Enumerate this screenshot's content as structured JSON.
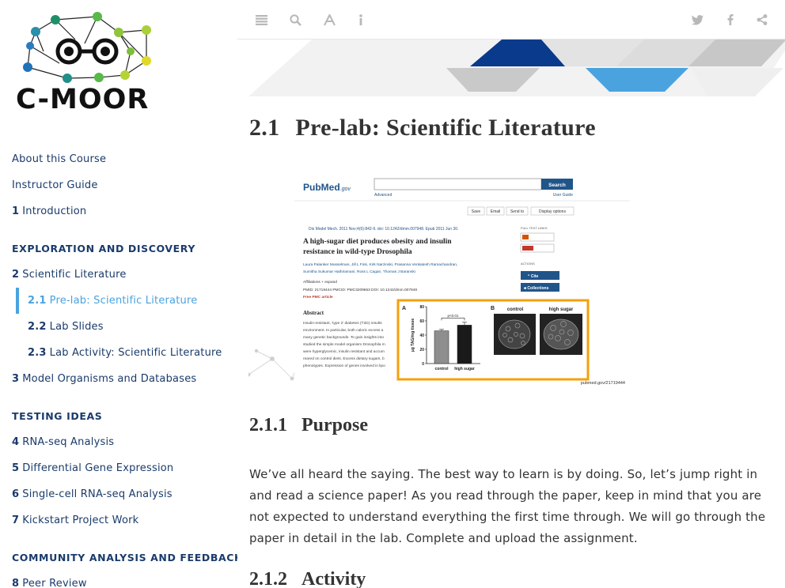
{
  "logo": {
    "text": "C-MOOR"
  },
  "sidebar": {
    "items": [
      {
        "type": "link",
        "num": "",
        "label": "About this Course"
      },
      {
        "type": "link",
        "num": "",
        "label": "Instructor Guide"
      },
      {
        "type": "link",
        "num": "1",
        "label": "Introduction"
      },
      {
        "type": "header",
        "num": "",
        "label": "EXPLORATION AND DISCOVERY"
      },
      {
        "type": "link",
        "num": "2",
        "label": "Scientific Literature"
      },
      {
        "type": "sub-active",
        "num": "2.1",
        "label": "Pre-lab: Scientific Literature"
      },
      {
        "type": "sub",
        "num": "2.2",
        "label": "Lab Slides"
      },
      {
        "type": "sub",
        "num": "2.3",
        "label": "Lab Activity: Scientific Literature"
      },
      {
        "type": "link",
        "num": "3",
        "label": "Model Organisms and Databases"
      },
      {
        "type": "header",
        "num": "",
        "label": "TESTING IDEAS"
      },
      {
        "type": "link",
        "num": "4",
        "label": "RNA-seq Analysis"
      },
      {
        "type": "link",
        "num": "5",
        "label": "Differential Gene Expression"
      },
      {
        "type": "link",
        "num": "6",
        "label": "Single-cell RNA-seq Analysis"
      },
      {
        "type": "link",
        "num": "7",
        "label": "Kickstart Project Work"
      },
      {
        "type": "header",
        "num": "",
        "label": "COMMUNITY ANALYSIS AND FEEDBACK"
      },
      {
        "type": "link",
        "num": "8",
        "label": "Peer Review"
      }
    ]
  },
  "toolbar": {
    "left_icons": [
      "menu-icon",
      "search-icon",
      "font-icon",
      "info-icon"
    ],
    "right_icons": [
      "twitter-icon",
      "facebook-icon",
      "share-icon"
    ]
  },
  "colors": {
    "accent": "#4aa3df",
    "nav": "#1a3b6b",
    "banner_dark": "#0a3a8c",
    "banner_light": "#4aa3df",
    "highlight": "#f5a00a"
  },
  "main": {
    "title_num": "2.1",
    "title": "Pre-lab: Scientific Literature",
    "section1_num": "2.1.1",
    "section1_title": "Purpose",
    "paragraph": "We’ve all heard the saying. The best way to learn is by doing. So, let’s jump right in and read a science paper! As you read through the paper, keep in mind that you are not expected to understand everything the first time through. We will go through the paper in detail in the lab. Complete and upload the assignment.",
    "section2_num": "2.1.2",
    "section2_title": "Activity"
  },
  "figure": {
    "brand_left": "Pub",
    "brand_right": "Med",
    "brand_gov": ".gov",
    "search_button": "Search",
    "advanced": "Advanced",
    "user_guide": "User Guide",
    "action_buttons": [
      "Save",
      "Email",
      "Send to",
      "Display options"
    ],
    "citation": "Dis Model Mech. 2011 Nov;4(6):842-9. doi: 10.1242/dmm.007948. Epub 2011 Jun 30.",
    "article_title_line1": "A high-sugar diet produces obesity and insulin",
    "article_title_line2": "resistance in wild-type Drosophila",
    "authors_line1": "Laura Palanker Musselman, Jill L Fink, Kirk Narzinski, Prasanna Venkatesh Ramachandran,",
    "authors_line2": "Sumitha Sukumar Hathiramani, Ross L Cagan, Thomas J Baranski",
    "affiliations": "Affiliations  + expand",
    "ids": "PMID: 21719444   PMCID: PMC3209653   DOI: 10.1242/dmm.007948",
    "free_pmc": "Free PMC article",
    "abstract_heading": "Abstract",
    "abstract_lines": [
      "Insulin-resistant, 'type 2' diabetes (T2D) results",
      "environment. In particular, both caloric excess a",
      "many genetic backgrounds. To gain insights into",
      "studied the simple model organism Drosophila m",
      "were hyperglycemic, insulin resistant and accum",
      "reared on control diets. Excess dietary sugars, b",
      "phenotypes. Expression of genes involved in lipo"
    ],
    "full_text_links": "FULL TEXT LINKS",
    "actions_label": "ACTIONS",
    "cite_button": "Cite",
    "collections_button": "Collections",
    "panel_a": "A",
    "panel_b": "B",
    "y_axis_label": "µg TAG/mg tissue",
    "p_value": "p<0.01",
    "bar_labels": [
      "control",
      "high sugar"
    ],
    "image_labels": [
      "control",
      "high sugar"
    ],
    "source": "pubmed.gov/21719444"
  },
  "chart_data": {
    "type": "bar",
    "categories": [
      "control",
      "high sugar"
    ],
    "values": [
      46,
      54
    ],
    "errors": [
      2,
      4
    ],
    "ylabel": "µg TAG/mg tissue",
    "yticks": [
      0,
      20,
      40,
      60,
      80
    ],
    "ylim": [
      0,
      80
    ],
    "annotation": "p<0.01"
  }
}
